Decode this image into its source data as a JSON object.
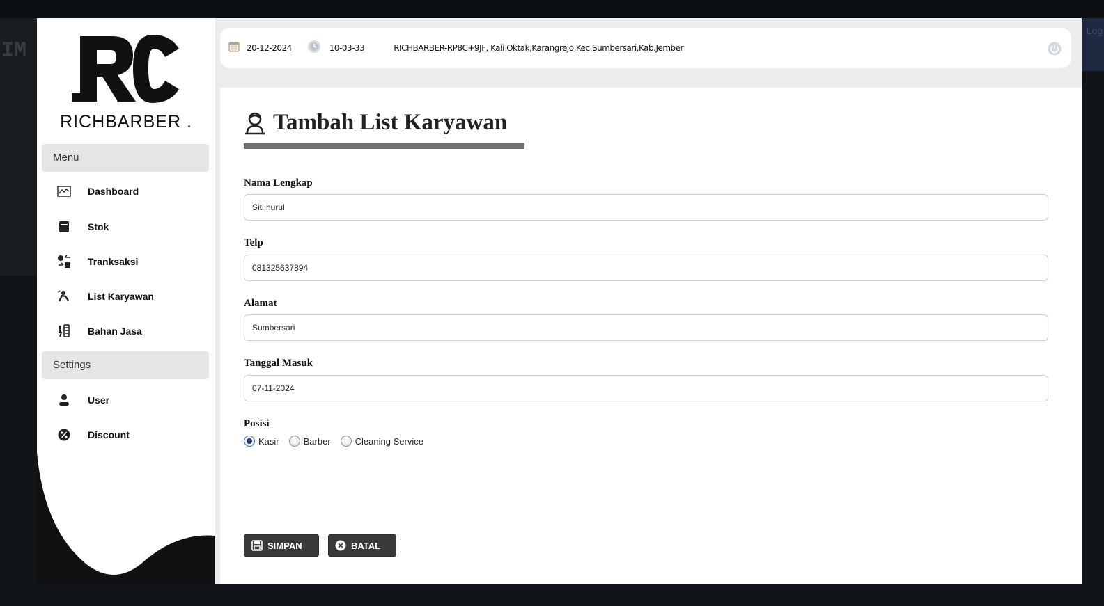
{
  "background_app": {
    "left_text": "IM",
    "right_text": "Log"
  },
  "brand": {
    "logo_mark": "RC",
    "name": "RICHBARBER ."
  },
  "sidebar": {
    "menu_heading": "Menu",
    "menu_items": [
      {
        "label": "Dashboard",
        "icon": "chart-icon"
      },
      {
        "label": "Stok",
        "icon": "box-icon"
      },
      {
        "label": "Tranksaksi",
        "icon": "transaction-icon"
      },
      {
        "label": "List Karyawan",
        "icon": "employee-icon"
      },
      {
        "label": "Bahan Jasa",
        "icon": "tools-icon"
      }
    ],
    "settings_heading": "Settings",
    "settings_items": [
      {
        "label": "User",
        "icon": "user-icon"
      },
      {
        "label": "Discount",
        "icon": "discount-icon"
      }
    ]
  },
  "topbar": {
    "date": "20-12-2024",
    "time": "10-03-33",
    "address": "RICHBARBER-RP8C+9JF, Kali Oktak,Karangrejo,Kec.Sumbersari,Kab.Jember"
  },
  "form": {
    "title": "Tambah List Karyawan",
    "fields": [
      {
        "label": "Nama Lengkap",
        "value": "Siti nurul"
      },
      {
        "label": "Telp",
        "value": "081325637894"
      },
      {
        "label": "Alamat",
        "value": "Sumbersari"
      },
      {
        "label": "Tanggal Masuk",
        "value": "07-11-2024"
      }
    ],
    "position_label": "Posisi",
    "position_options": [
      "Kasir",
      "Barber",
      "Cleaning Service"
    ],
    "position_selected": "Kasir",
    "save_label": "SIMPAN",
    "cancel_label": "BATAL"
  },
  "colors": {
    "accent_dark": "#3a3a3a",
    "underline": "#6f6f6f",
    "panel_bg": "#ececec"
  }
}
